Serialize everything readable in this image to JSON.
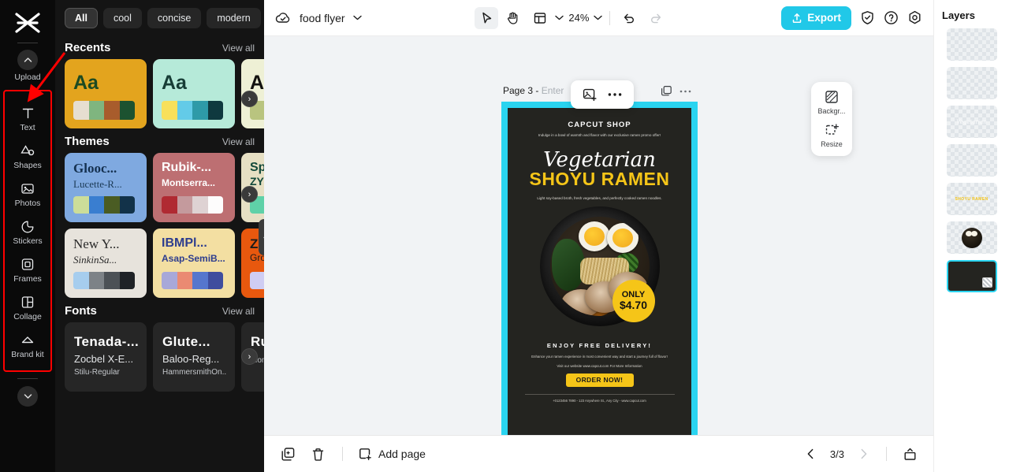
{
  "app": {
    "logo_name": "capcut-logo"
  },
  "rail": {
    "upload_label": "Upload",
    "items": [
      {
        "label": "Text",
        "icon": "text-icon"
      },
      {
        "label": "Shapes",
        "icon": "shapes-icon"
      },
      {
        "label": "Photos",
        "icon": "photos-icon"
      },
      {
        "label": "Stickers",
        "icon": "stickers-icon"
      },
      {
        "label": "Frames",
        "icon": "frames-icon"
      },
      {
        "label": "Collage",
        "icon": "collage-icon"
      },
      {
        "label": "Brand kit",
        "icon": "brandkit-icon"
      }
    ]
  },
  "panel": {
    "chips": [
      "All",
      "cool",
      "concise",
      "modern"
    ],
    "chip_more_icon": "chevron-down-icon",
    "view_all": "View all",
    "sections": [
      {
        "title": "Recents"
      },
      {
        "title": "Themes"
      },
      {
        "title": "Fonts"
      }
    ],
    "recents": [
      {
        "sample": "Aa",
        "bg": "#e3a41e",
        "text_color": "#1c4a22",
        "swatches": [
          "#e6ded0",
          "#7fb57f",
          "#a85c2c",
          "#1c5230"
        ]
      },
      {
        "sample": "Aa",
        "bg": "#b6ead9",
        "text_color": "#173d36",
        "swatches": [
          "#f8e05a",
          "#63cbe8",
          "#2e9aa8",
          "#0f393f"
        ]
      },
      {
        "sample": "A",
        "bg": "#eef0d5",
        "text_color": "#12110f",
        "swatches": [
          "#b9c47f",
          "#b9c47f",
          "#b9c47f",
          "#b9c47f"
        ]
      }
    ],
    "themes": [
      {
        "l1": "Glooc...",
        "l2": "Lucette-R...",
        "bg": "#7fa9e0",
        "c1": "#14304f",
        "c2": "#1b3a56",
        "swatches": [
          "#ccdd99",
          "#3a7ed0",
          "#4a5c23",
          "#123249"
        ]
      },
      {
        "l1": "Rubik-...",
        "l2": "Montserra...",
        "bg": "#bd6f72",
        "c1": "#ffffff",
        "c2": "#ffffff",
        "swatches": [
          "#b02a32",
          "#c49a9d",
          "#ded2d3",
          "#fdfcfc"
        ]
      },
      {
        "l1": "Sp",
        "l2": "ZY",
        "bg": "#e6dfc3",
        "c1": "#11483a",
        "c2": "#11483a",
        "swatches": [
          "#5fd1a8",
          "#5fd1a8",
          "#5fd1a8",
          "#5fd1a8"
        ]
      },
      {
        "l1": "New Y...",
        "l2": "SinkinSa...",
        "bg": "#e7e3dc",
        "c1": "#2a2a2a",
        "c2": "#2a2a2a",
        "swatches": [
          "#a6cdee",
          "#7d8287",
          "#4c5156",
          "#1f2226"
        ]
      },
      {
        "l1": "IBMPl...",
        "l2": "Asap-SemiB...",
        "bg": "#f3dfa2",
        "c1": "#2d3d8e",
        "c2": "#2d3d8e",
        "swatches": [
          "#a8a8d8",
          "#ea8a72",
          "#5676cd",
          "#3f4d9e"
        ]
      },
      {
        "l1": "ZY",
        "l2": "Gro",
        "bg": "#e8580e",
        "c1": "#1b1b1b",
        "c2": "#1b1b1b",
        "swatches": [
          "#cfcdf3",
          "#cfcdf3",
          "#cfcdf3",
          "#cfcdf3"
        ]
      }
    ],
    "fonts": [
      {
        "l1": "Tenada-...",
        "l2": "Zocbel X-E...",
        "l3": "Stilu-Regular"
      },
      {
        "l1": "Glute...",
        "l2": "Baloo-Reg...",
        "l3": "HammersmithOn..."
      },
      {
        "l1": "Ru",
        "l2": "",
        "l3": "Mon"
      }
    ],
    "next_arrow_icon": "chevron-right-icon",
    "collapse_icon": "chevron-left-icon"
  },
  "topbar": {
    "cloud_icon": "cloud-check-icon",
    "doc_title": "food flyer",
    "doc_caret_icon": "chevron-down-icon",
    "select_tool_icon": "cursor-icon",
    "hand_tool_icon": "hand-icon",
    "layout_tool_icon": "layout-icon",
    "layout_caret_icon": "chevron-down-icon",
    "zoom_value": "24%",
    "zoom_caret_icon": "chevron-down-icon",
    "undo_icon": "undo-icon",
    "redo_icon": "redo-icon",
    "export_label": "Export",
    "export_icon": "upload-icon",
    "export_color": "#21c8e8",
    "shield_icon": "shield-check-icon",
    "help_icon": "question-circle-icon",
    "settings_icon": "gear-icon"
  },
  "canvas": {
    "page_label": "Page 3 -",
    "page_name_placeholder": "Enter",
    "float_image_icon": "add-image-icon",
    "float_more_icon": "more-horizontal-icon",
    "duplicate_icon": "duplicate-icon",
    "more_icon": "more-horizontal-icon"
  },
  "flyer": {
    "brand": "CAPCUT SHOP",
    "subtitle": "Indulge in a bowl of warmth and flavor with our exclusive ramen promo offer!",
    "script_title": "Vegetarian",
    "main_title": "SHOYU RAMEN",
    "description": "Light soy-based broth, fresh vegetables, and perfectly cooked ramen noodles.",
    "badge_line1": "ONLY",
    "badge_line2": "$4.70",
    "delivery_heading": "ENJOY FREE DELIVERY!",
    "body": "Enhance your ramen experience in most convenient way and start a journey full of flavor!",
    "visit": "Visit our website www.capcut.com For More Information",
    "order_label": "ORDER NOW!",
    "footer": "+0123456 7890 - 123 Anywhere St., Any City - www.capcut.com",
    "accent_color": "#f5c518",
    "bg_color": "#242420",
    "selection_color": "#2ad4f0"
  },
  "right_float": {
    "items": [
      {
        "label": "Backgr...",
        "icon": "background-icon"
      },
      {
        "label": "Resize",
        "icon": "resize-icon"
      }
    ]
  },
  "layers": {
    "title": "Layers",
    "items": [
      {
        "kind": "empty",
        "label": ""
      },
      {
        "kind": "empty",
        "label": ""
      },
      {
        "kind": "script",
        "label": "Vegetarian"
      },
      {
        "kind": "empty",
        "label": ""
      },
      {
        "kind": "text",
        "label": "SHOYU RAMEN"
      },
      {
        "kind": "image",
        "label": ""
      },
      {
        "kind": "background",
        "label": "",
        "selected": true
      }
    ]
  },
  "bottombar": {
    "duplicate_icon": "duplicate-page-icon",
    "delete_icon": "trash-icon",
    "add_page_label": "Add page",
    "add_page_icon": "add-square-icon",
    "prev_icon": "chevron-left-icon",
    "next_icon": "chevron-right-icon",
    "page_indicator": "3/3",
    "present_icon": "present-icon"
  }
}
